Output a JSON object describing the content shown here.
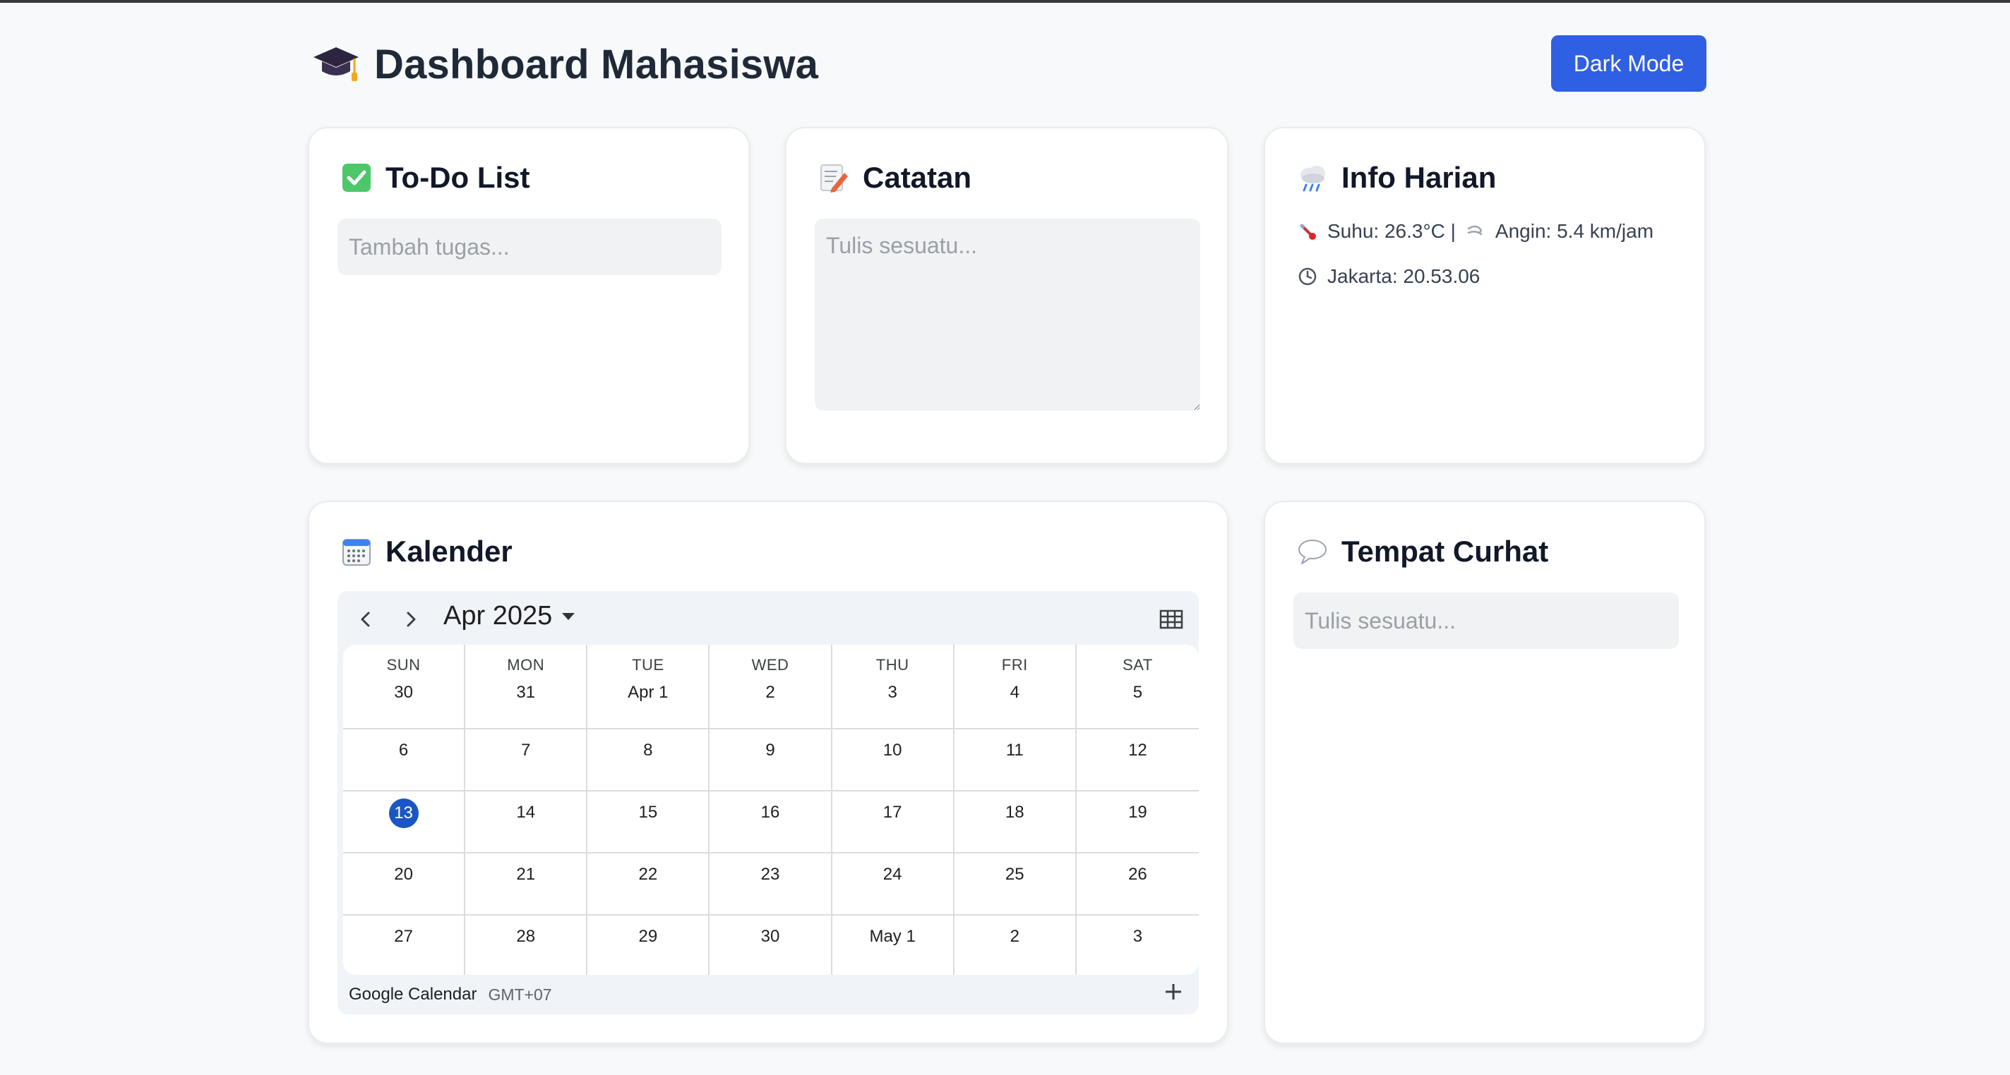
{
  "header": {
    "title": "Dashboard Mahasiswa",
    "dark_mode_label": "Dark Mode"
  },
  "todo": {
    "title": "To-Do List",
    "placeholder": "Tambah tugas..."
  },
  "notes": {
    "title": "Catatan",
    "placeholder": "Tulis sesuatu..."
  },
  "info": {
    "title": "Info Harian",
    "weather_text": "Suhu: 26.3°C |",
    "wind_text": "Angin: 5.4 km/jam",
    "clock_text": "Jakarta: 20.53.06"
  },
  "calendar": {
    "title": "Kalender",
    "month_label": "Apr 2025",
    "weekdays": [
      "SUN",
      "MON",
      "TUE",
      "WED",
      "THU",
      "FRI",
      "SAT"
    ],
    "weeks": [
      [
        "30",
        "31",
        "Apr 1",
        "2",
        "3",
        "4",
        "5"
      ],
      [
        "6",
        "7",
        "8",
        "9",
        "10",
        "11",
        "12"
      ],
      [
        "13",
        "14",
        "15",
        "16",
        "17",
        "18",
        "19"
      ],
      [
        "20",
        "21",
        "22",
        "23",
        "24",
        "25",
        "26"
      ],
      [
        "27",
        "28",
        "29",
        "30",
        "May 1",
        "2",
        "3"
      ]
    ],
    "today": "13",
    "footer_brand": "Google Calendar",
    "timezone": "GMT+07"
  },
  "curhat": {
    "title": "Tempat Curhat",
    "placeholder": "Tulis sesuatu..."
  },
  "colors": {
    "accent": "#2f5fe3",
    "today": "#1a56c4",
    "background": "#f8f9fb"
  }
}
